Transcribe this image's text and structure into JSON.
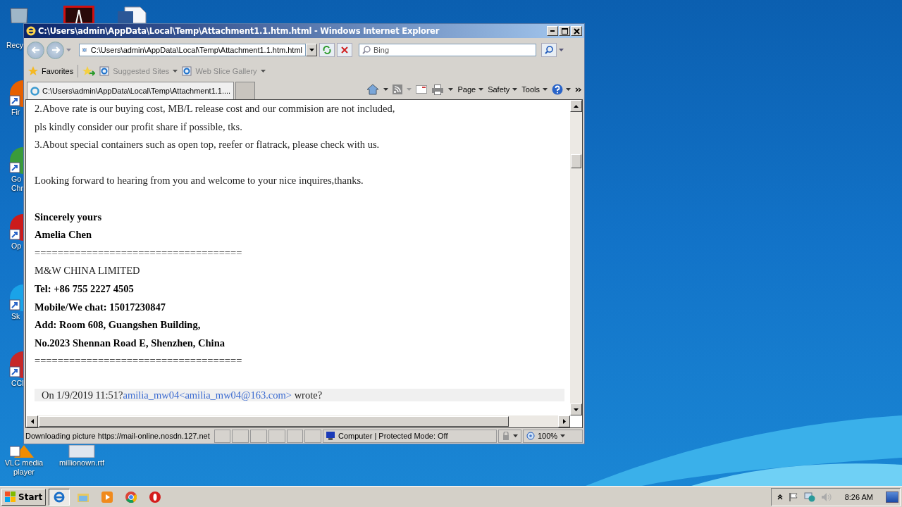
{
  "desktop_icons": [
    {
      "kind": "bin",
      "label": "Recy"
    },
    {
      "kind": "pdf"
    },
    {
      "kind": "doc"
    },
    {
      "kind": "firefox",
      "label": "Fir"
    },
    {
      "kind": "chrome",
      "label": "Go\nChr"
    },
    {
      "kind": "opera",
      "label": "Op"
    },
    {
      "kind": "skype",
      "label": "Sk"
    },
    {
      "kind": "ccleaner",
      "label": "CCl"
    },
    {
      "kind": "vlc",
      "label": "VLC media\nplayer"
    },
    {
      "kind": "rtf",
      "label": "millionown.rtf"
    }
  ],
  "window": {
    "title": "C:\\Users\\admin\\AppData\\Local\\Temp\\Attachment1.1.htm.html - Windows Internet Explorer",
    "address": "C:\\Users\\admin\\AppData\\Local\\Temp\\Attachment1.1.htm.html",
    "search_placeholder": "Bing",
    "favorites": [
      {
        "label": "Favorites",
        "kind": "star"
      },
      {
        "label": "Suggested Sites",
        "kind": "ie"
      },
      {
        "label": "Web Slice Gallery",
        "kind": "ie"
      }
    ],
    "tabs": [
      {
        "kind": "page",
        "label": "C:\\Users\\admin\\AppData\\Local\\Temp\\Attachment1.1....",
        "selected": true
      },
      {
        "kind": "new",
        "selected": false
      }
    ],
    "commands": [
      "Page",
      "Safety",
      "Tools"
    ],
    "content": [
      {
        "kind": "text",
        "text": "2.Above rate is our buying cost, MB/L release cost and our commision are not included,"
      },
      {
        "kind": "text",
        "text": "pls kindly consider our profit share if possible, tks."
      },
      {
        "kind": "text",
        "text": "3.About special containers such as open top, reefer or flatrack, please check with us."
      },
      {
        "kind": "blank"
      },
      {
        "kind": "text",
        "text": "Looking forward to hearing from you and welcome to your nice inquires,thanks."
      },
      {
        "kind": "blank"
      },
      {
        "kind": "bold",
        "text": "Sincerely yours"
      },
      {
        "kind": "bold",
        "text": "Amelia Chen"
      },
      {
        "kind": "text",
        "text": "===================================="
      },
      {
        "kind": "text",
        "text": "M&W CHINA LIMITED"
      },
      {
        "kind": "bold",
        "text": "Tel: +86 755 2227 4505"
      },
      {
        "kind": "bold",
        "text": "Mobile/We chat: 15017230847"
      },
      {
        "kind": "bold",
        "text": "Add: Room 608, Guangshen Building,"
      },
      {
        "kind": "bold",
        "text": "No.2023 Shennan Road E, Shenzhen, China"
      },
      {
        "kind": "text",
        "text": "===================================="
      },
      {
        "kind": "blank"
      },
      {
        "kind": "quote",
        "text": "On 1/9/2019 11:51?",
        "link": "amilia_mw04<amilia_mw04@163.com>",
        "after": " wrote?"
      }
    ],
    "status": {
      "text": "Downloading picture https://mail-online.nosdn.127.net",
      "zone": "Computer | Protected Mode: Off",
      "zoom": "100%"
    }
  },
  "taskbar": {
    "start": "Start",
    "apps": [
      {
        "kind": "ie",
        "selected": true
      },
      {
        "kind": "folder",
        "selected": false
      },
      {
        "kind": "media",
        "selected": false
      },
      {
        "kind": "chrome",
        "selected": false
      },
      {
        "kind": "opera",
        "selected": false
      }
    ],
    "clock": "8:26 AM"
  }
}
